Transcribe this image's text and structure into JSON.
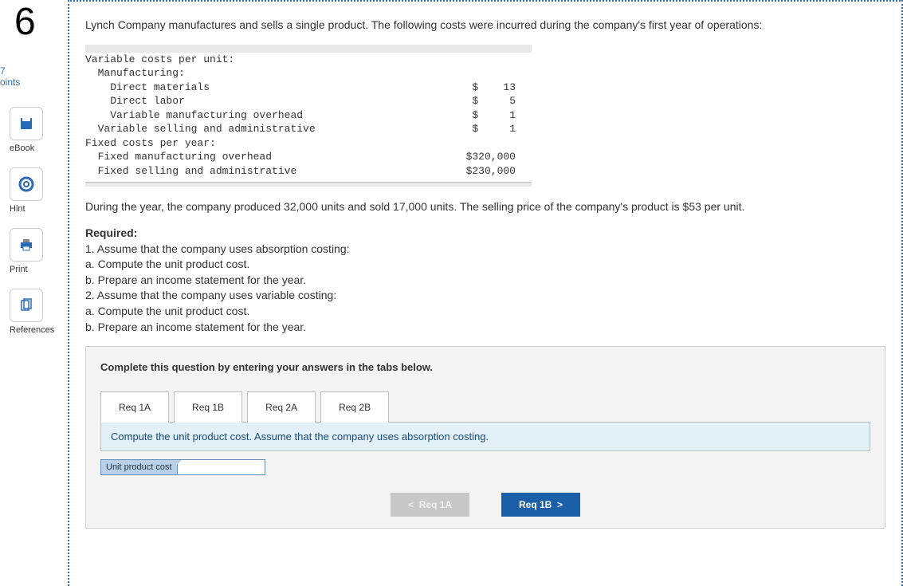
{
  "question_number": "6",
  "points_label": "7\noints",
  "tools": {
    "ebook": "eBook",
    "hint": "Hint",
    "print": "Print",
    "references": "References"
  },
  "intro": "Lynch Company manufactures and sells a single product. The following costs were incurred during the company's first year of operations:",
  "cost_table": {
    "h1": "Variable costs per unit:",
    "h2": "  Manufacturing:",
    "r1_label": "    Direct materials",
    "r1_amt": "$    13",
    "r2_label": "    Direct labor",
    "r2_amt": "$     5",
    "r3_label": "    Variable manufacturing overhead",
    "r3_amt": "$     1",
    "r4_label": "  Variable selling and administrative",
    "r4_amt": "$     1",
    "h3": "Fixed costs per year:",
    "r5_label": "  Fixed manufacturing overhead",
    "r5_amt": "$320,000",
    "r6_label": "  Fixed selling and administrative",
    "r6_amt": "$230,000"
  },
  "during_text": "During the year, the company produced 32,000 units and sold 17,000 units. The selling price of the company's product is $53 per unit.",
  "required": {
    "head": "Required:",
    "l1": "1. Assume that the company uses absorption costing:",
    "l1a": "a. Compute the unit product cost.",
    "l1b": "b. Prepare an income statement for the year.",
    "l2": "2. Assume that the company uses variable costing:",
    "l2a": "a. Compute the unit product cost.",
    "l2b": "b. Prepare an income statement for the year."
  },
  "answer": {
    "instruction": "Complete this question by entering your answers in the tabs below.",
    "tabs": [
      "Req 1A",
      "Req 1B",
      "Req 2A",
      "Req 2B"
    ],
    "prompt": "Compute the unit product cost. Assume that the company uses absorption costing.",
    "field_label": "Unit product cost",
    "prev": "Req 1A",
    "next": "Req 1B"
  }
}
